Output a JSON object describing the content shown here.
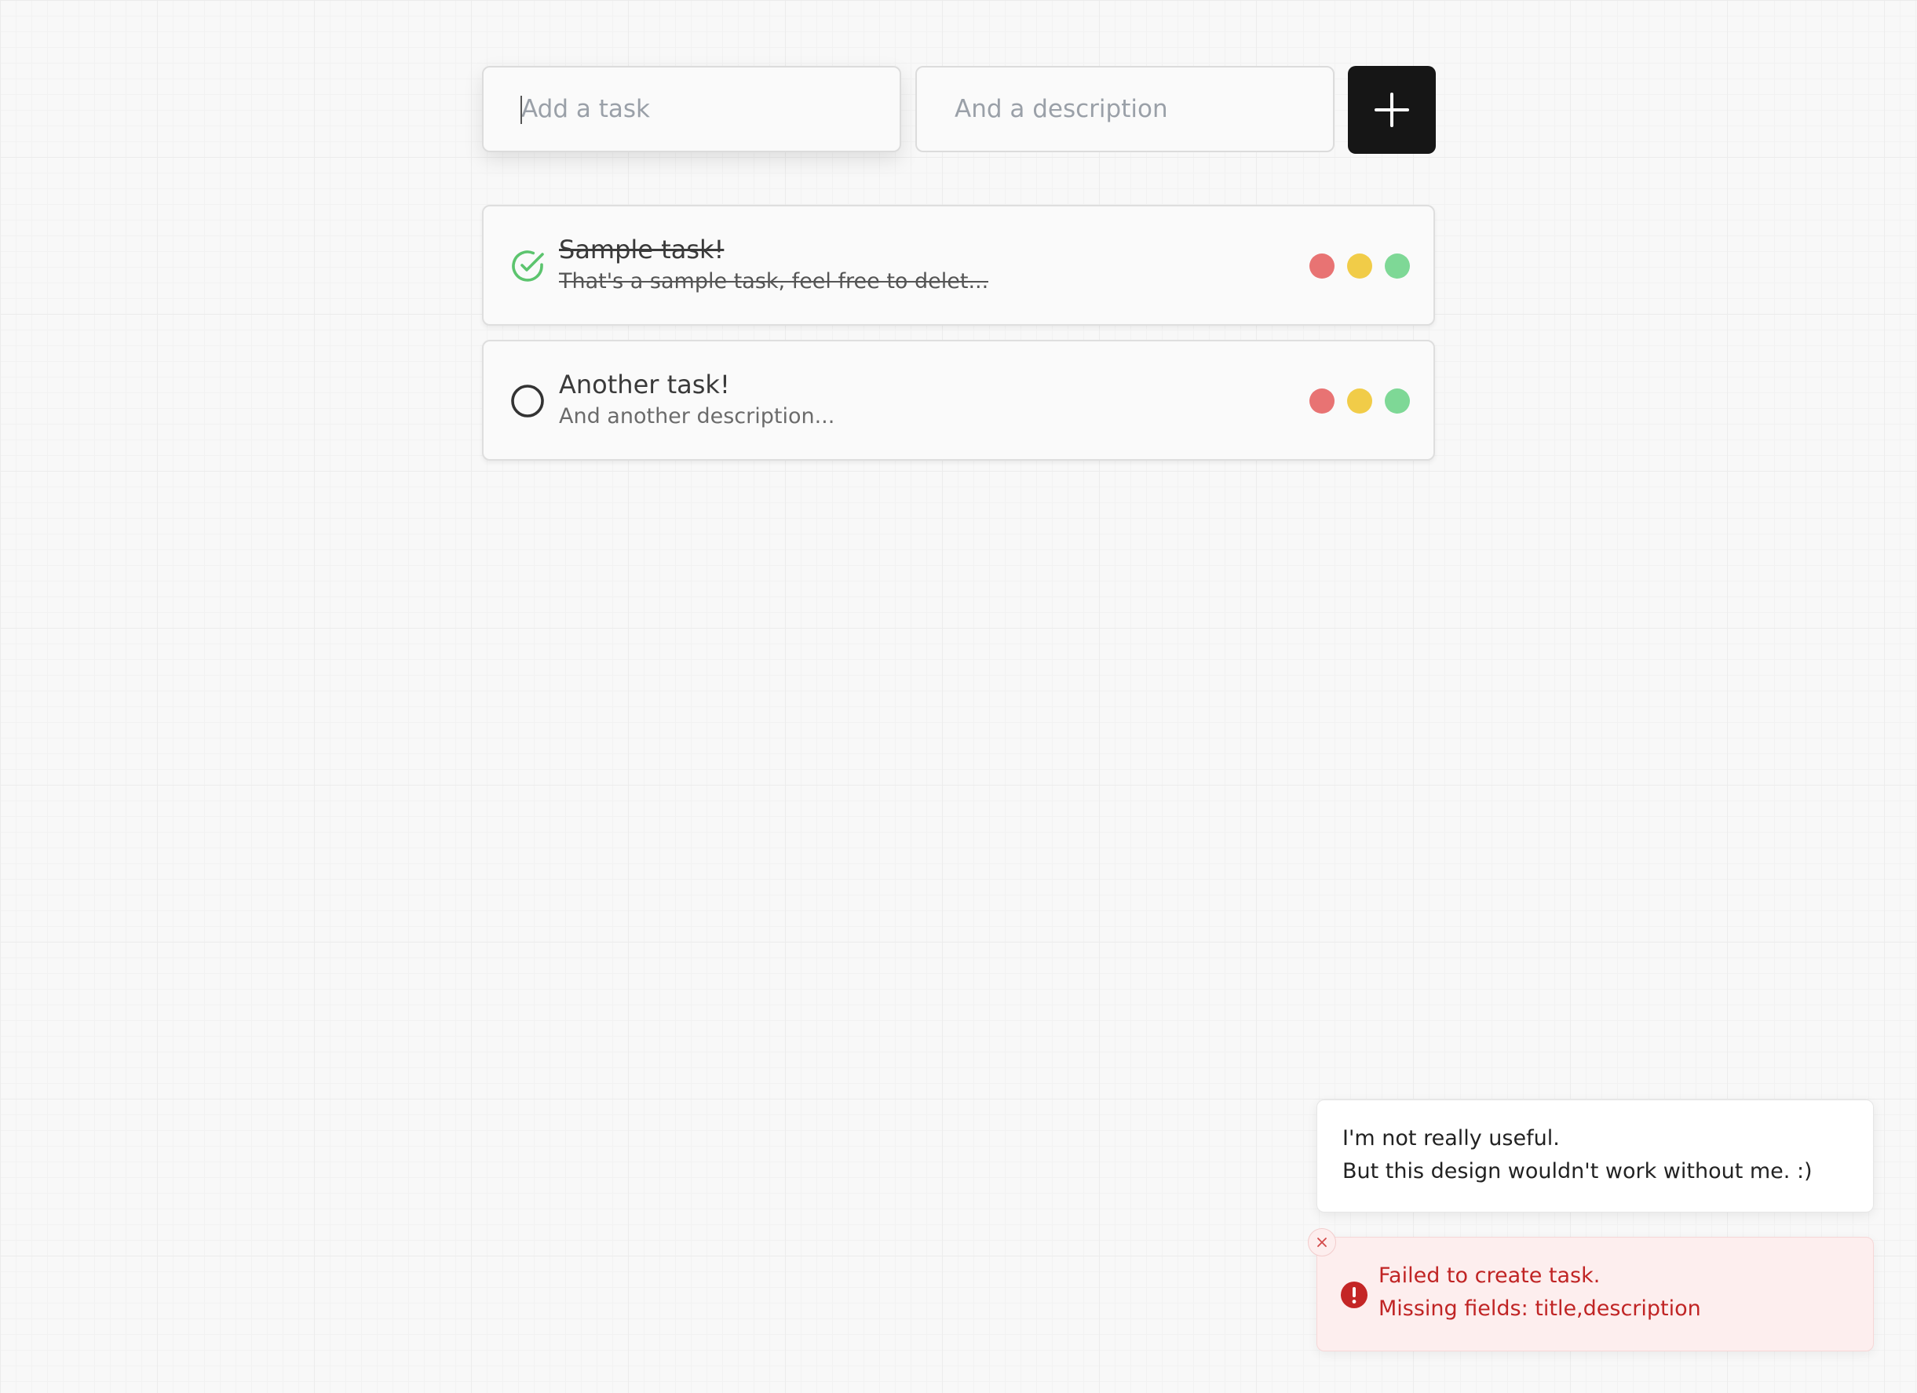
{
  "form": {
    "title_placeholder": "Add a task",
    "title_value": "",
    "description_placeholder": "And a description",
    "description_value": "",
    "add_icon": "plus-icon"
  },
  "tasks": [
    {
      "title": "Sample task!",
      "description": "That's a sample task, feel free to delet...",
      "completed": true,
      "status_icon": "check-circle-icon"
    },
    {
      "title": "Another task!",
      "description": "And another description...",
      "completed": false,
      "status_icon": "empty-circle-icon"
    }
  ],
  "priority_colors": {
    "red": "#e87373",
    "yellow": "#f1cc48",
    "green": "#7ed896"
  },
  "toasts": {
    "info": {
      "line1": "I'm not really useful.",
      "line2": "But this design wouldn't work without me. :)"
    },
    "error": {
      "line1": "Failed to create task.",
      "line2": "Missing fields: title,description",
      "icon": "error-circle-icon",
      "close_icon": "close-icon"
    }
  },
  "colors": {
    "accent_dark": "#161616",
    "success": "#5cc46e",
    "error": "#c02424",
    "error_bg": "#fdeeee"
  }
}
